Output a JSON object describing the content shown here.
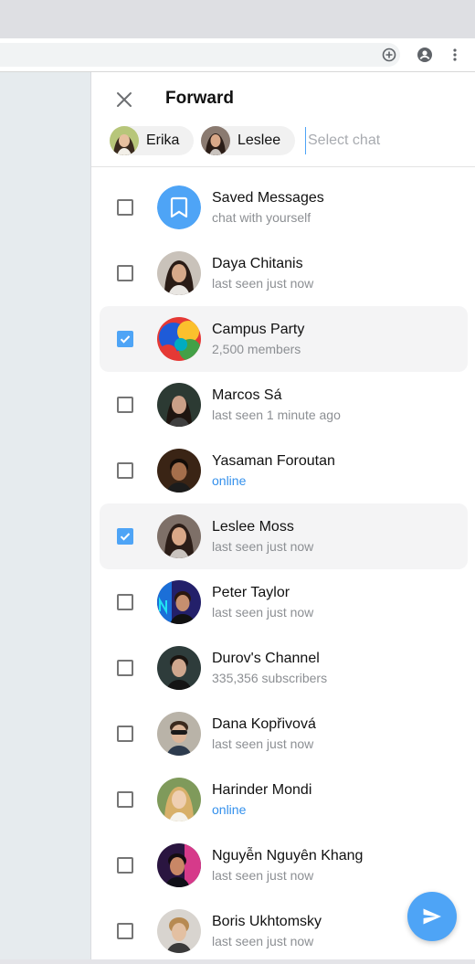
{
  "header": {
    "title": "Forward"
  },
  "selected_chips": [
    {
      "label": "Erika",
      "avatar": "woman-smiling-avatar"
    },
    {
      "label": "Leslee",
      "avatar": "woman-dark-hair-avatar"
    }
  ],
  "search": {
    "placeholder": "Select chat",
    "value": ""
  },
  "chats": [
    {
      "name": "Saved Messages",
      "status": "chat with yourself",
      "checked": false,
      "avatar": "bookmark-icon"
    },
    {
      "name": "Daya Chitanis",
      "status": "last seen just now",
      "checked": false,
      "avatar": "person-avatar"
    },
    {
      "name": "Campus Party",
      "status": "2,500 members",
      "checked": true,
      "avatar": "colorful-balloons-avatar"
    },
    {
      "name": "Marcos Sá",
      "status": "last seen 1 minute ago",
      "checked": false,
      "avatar": "person-avatar"
    },
    {
      "name": "Yasaman Foroutan",
      "status": "online",
      "checked": false,
      "avatar": "person-avatar"
    },
    {
      "name": "Leslee Moss",
      "status": "last seen just now",
      "checked": true,
      "avatar": "person-avatar"
    },
    {
      "name": "Peter Taylor",
      "status": "last seen just now",
      "checked": false,
      "avatar": "neon-person-avatar"
    },
    {
      "name": "Durov's Channel",
      "status": "335,356 subscribers",
      "checked": false,
      "avatar": "person-avatar"
    },
    {
      "name": "Dana Kopřivová",
      "status": "last seen just now",
      "checked": false,
      "avatar": "person-avatar"
    },
    {
      "name": "Harinder Mondi",
      "status": "online",
      "checked": false,
      "avatar": "person-avatar"
    },
    {
      "name": "Nguyễn Nguyên Khang",
      "status": "last seen just now",
      "checked": false,
      "avatar": "person-avatar"
    },
    {
      "name": "Boris Ukhtomsky",
      "status": "last seen just now",
      "checked": false,
      "avatar": "person-avatar"
    }
  ],
  "colors": {
    "accent": "#4ea4f6",
    "online": "#3390ec",
    "selected_row_bg": "#f4f4f5"
  }
}
